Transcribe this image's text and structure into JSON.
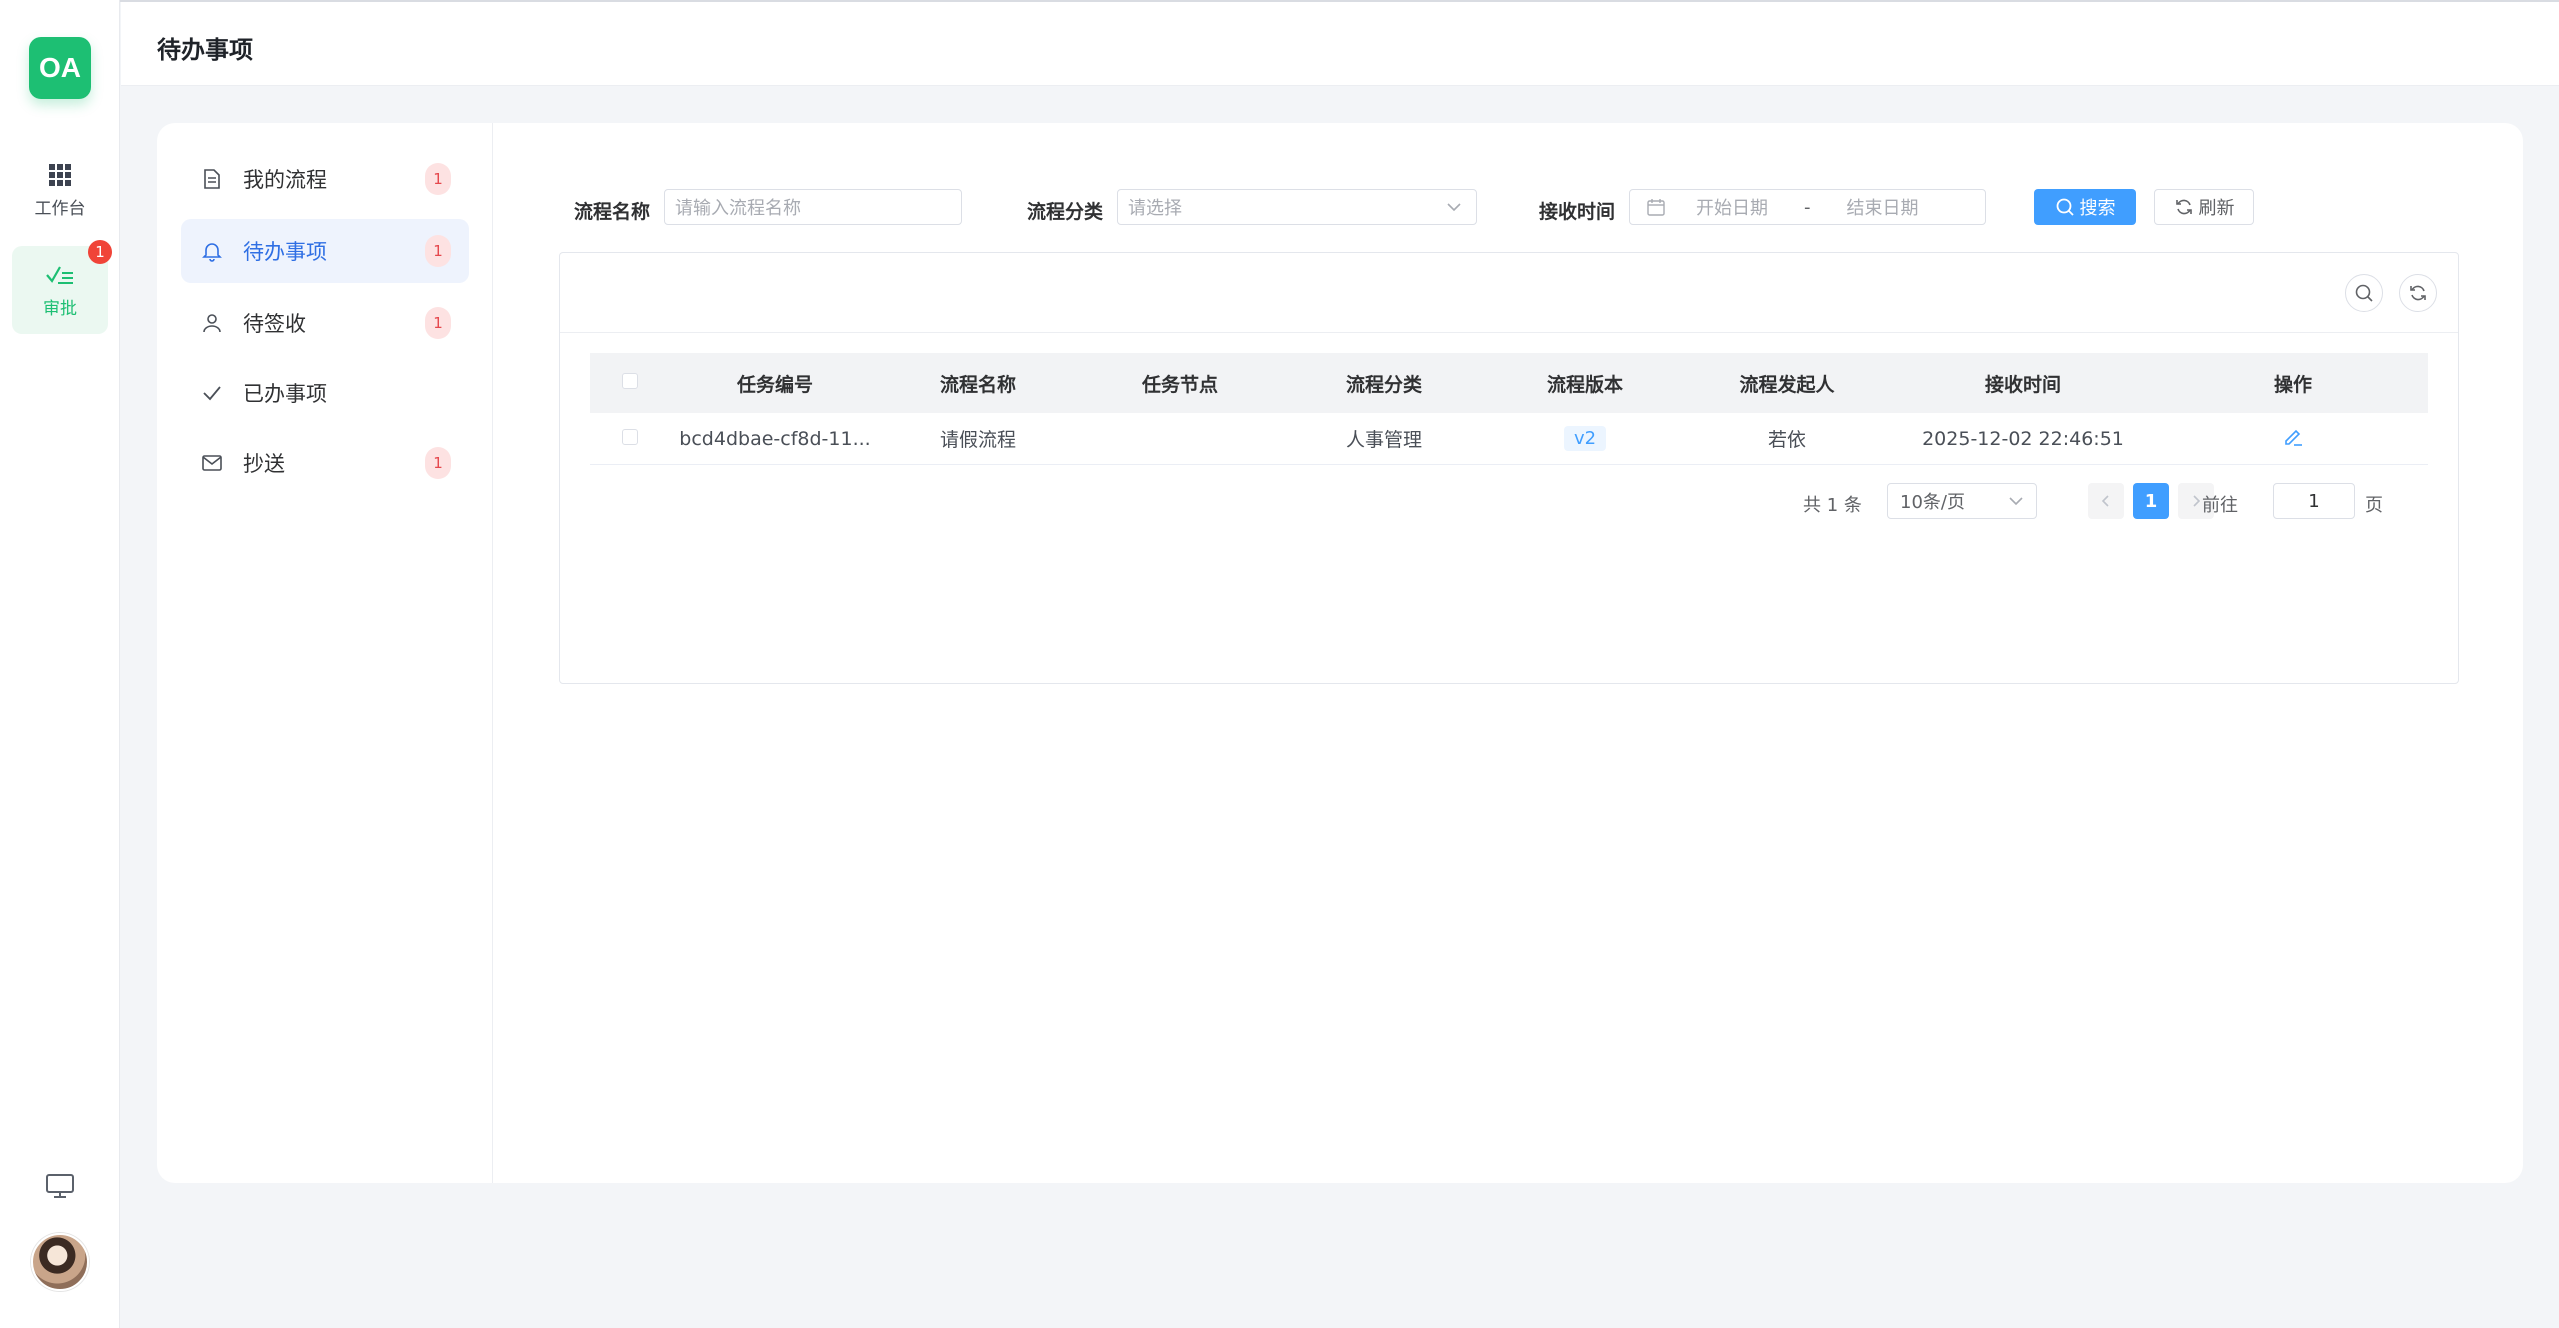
{
  "app": {
    "logo_text": "OA",
    "page_title": "待办事项"
  },
  "rail": {
    "items": [
      {
        "label": "工作台",
        "icon": "grid-icon",
        "active": false
      },
      {
        "label": "审批",
        "icon": "approval-check-icon",
        "active": true,
        "badge": "1"
      }
    ],
    "bottom_icon": "monitor-icon"
  },
  "subnav": {
    "items": [
      {
        "label": "我的流程",
        "icon": "document-icon",
        "badge": "1"
      },
      {
        "label": "待办事项",
        "icon": "bell-icon",
        "badge": "1",
        "active": true
      },
      {
        "label": "待签收",
        "icon": "user-icon",
        "badge": "1"
      },
      {
        "label": "已办事项",
        "icon": "check-icon"
      },
      {
        "label": "抄送",
        "icon": "mail-icon",
        "badge": "1"
      }
    ]
  },
  "filters": {
    "process_name_label": "流程名称",
    "process_name_placeholder": "请输入流程名称",
    "category_label": "流程分类",
    "category_placeholder": "请选择",
    "receive_time_label": "接收时间",
    "start_date_placeholder": "开始日期",
    "range_separator": "-",
    "end_date_placeholder": "结束日期",
    "search_label": "搜索",
    "refresh_label": "刷新"
  },
  "table": {
    "columns": [
      "任务编号",
      "流程名称",
      "任务节点",
      "流程分类",
      "流程版本",
      "流程发起人",
      "接收时间",
      "操作"
    ],
    "rows": [
      {
        "task_id": "bcd4dbae-cf8d-11...",
        "process_name": "请假流程",
        "task_node": "",
        "category": "人事管理",
        "version": "v2",
        "initiator": "若依",
        "receive_time": "2025-12-02 22:46:51",
        "action_icon": "edit-icon"
      }
    ]
  },
  "pagination": {
    "total_text": "共 1 条",
    "page_size": "10条/页",
    "current_page": "1",
    "goto_label": "前往",
    "goto_value": "1",
    "page_suffix": "页"
  },
  "colors": {
    "brand": "#1dbf73",
    "primary": "#409eff",
    "danger": "#f04438"
  }
}
